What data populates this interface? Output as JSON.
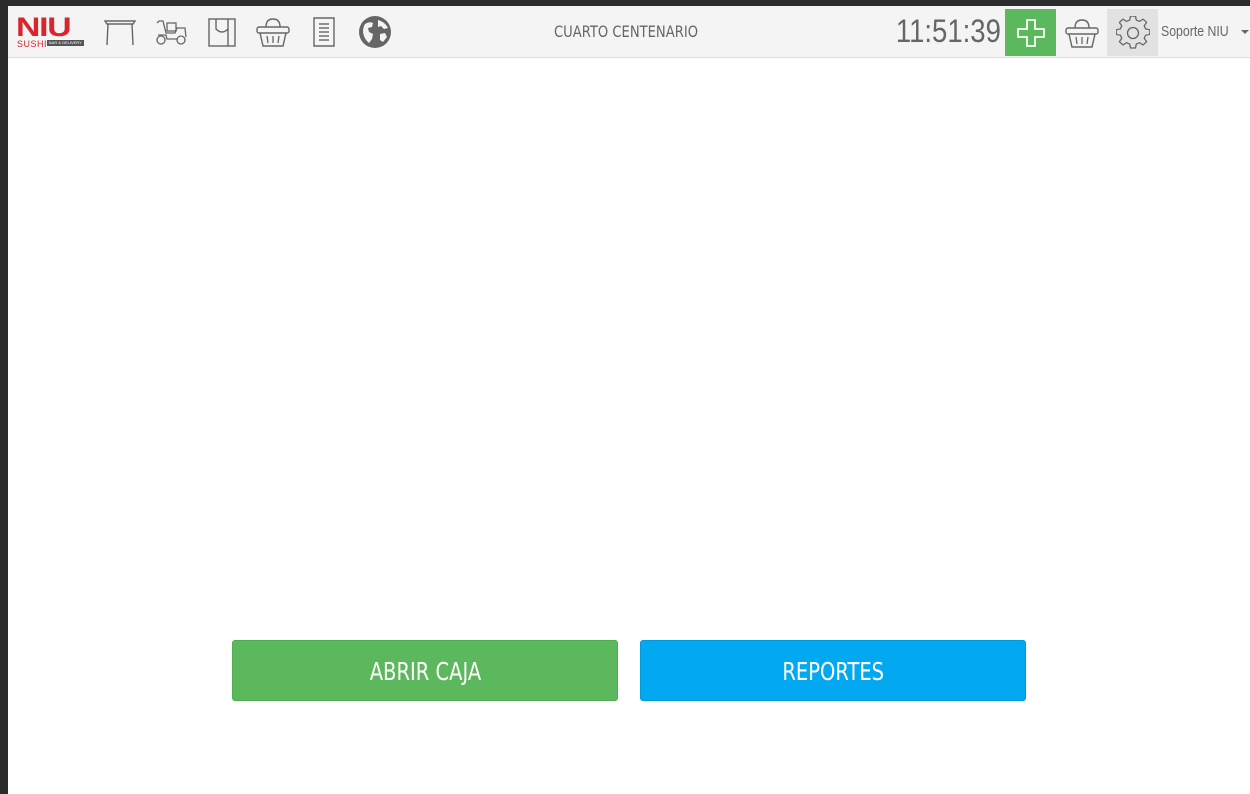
{
  "logo": {
    "main": "NIU",
    "sub": "SUSHI",
    "tag": "BAR & DELIVERY"
  },
  "nav": {
    "icons": [
      "table-icon",
      "delivery-scooter-icon",
      "takeaway-bag-icon",
      "basket-icon",
      "receipt-icon",
      "globe-icon"
    ]
  },
  "header": {
    "branch": "CUARTO CENTENARIO",
    "clock": "11:51:39",
    "user": "Soporte NIU"
  },
  "actions": {
    "open_register": "ABRIR CAJA",
    "reports": "REPORTES"
  },
  "colors": {
    "green": "#5cb85c",
    "blue": "#03a9f0",
    "brand_red": "#d7262e",
    "icon_gray": "#666666"
  }
}
